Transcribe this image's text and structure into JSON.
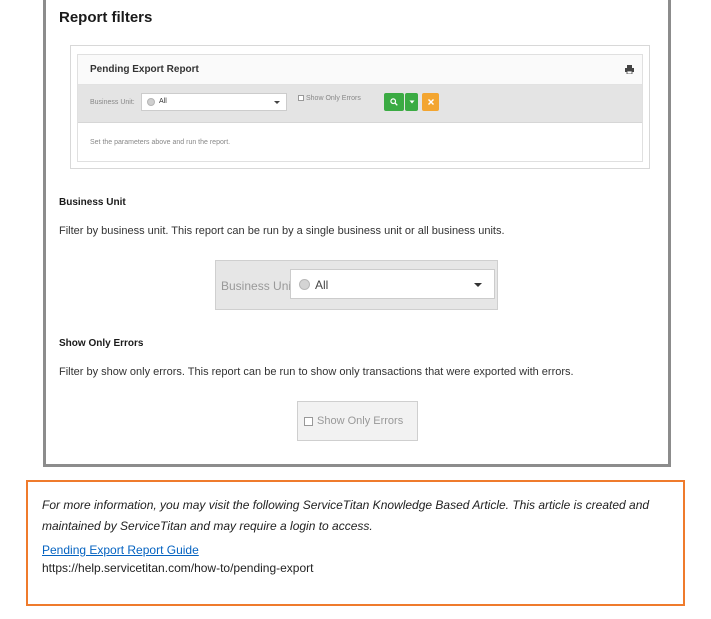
{
  "page": {
    "title": "Report filters"
  },
  "report_widget": {
    "title": "Pending Export Report",
    "filter_label": "Business Unit:",
    "select_value": "All",
    "checkbox_label": "Show Only Errors",
    "message": "Set the parameters above and run the report.",
    "colors": {
      "run": "#3bab43",
      "clear": "#f3a530"
    }
  },
  "business_unit_section": {
    "heading": "Business Unit",
    "text": "Filter by business unit. This report can be run by a single business unit or all business units.",
    "demo_label": "Business Unit:",
    "demo_value": "All"
  },
  "errors_section": {
    "heading": "Show Only Errors",
    "text": "Filter by show only errors. This report can be run to show only transactions that were exported with errors.",
    "demo_label": "Show Only Errors"
  },
  "note": {
    "text": "For more information, you may visit the following ServiceTitan Knowledge Based Article. This article is created and maintained by ServiceTitan and may require a login to access.",
    "link_text": "Pending Export Report Guide",
    "url": "https://help.servicetitan.com/how-to/pending-export",
    "border_color": "#ef7b2c"
  }
}
